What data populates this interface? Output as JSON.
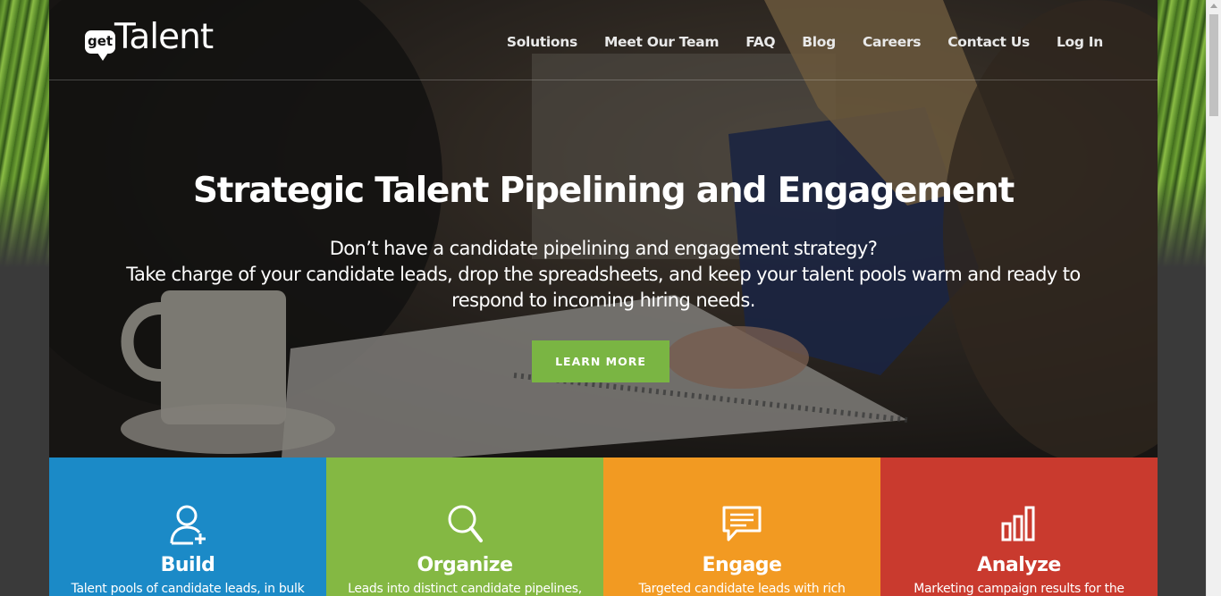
{
  "logo": {
    "badge": "get",
    "text": "Talent"
  },
  "nav": {
    "items": [
      {
        "label": "Solutions"
      },
      {
        "label": "Meet Our Team"
      },
      {
        "label": "FAQ"
      },
      {
        "label": "Blog"
      },
      {
        "label": "Careers"
      },
      {
        "label": "Contact Us"
      },
      {
        "label": "Log In"
      }
    ]
  },
  "hero": {
    "title": "Strategic Talent Pipelining and Engagement",
    "subtitle_line1": "Don’t have a candidate pipelining and engagement strategy?",
    "subtitle_line2": "Take charge of your candidate leads, drop the spreadsheets, and keep your talent pools warm and ready to respond to incoming hiring needs.",
    "cta_label": "LEARN MORE"
  },
  "tiles": [
    {
      "title": "Build",
      "desc": "Talent pools of candidate leads, in bulk",
      "color": "#1b8ac7",
      "icon": "add-user-icon"
    },
    {
      "title": "Organize",
      "desc": "Leads into distinct candidate pipelines,",
      "color": "#84b843",
      "icon": "search-icon"
    },
    {
      "title": "Engage",
      "desc": "Targeted candidate leads with rich",
      "color": "#f29a22",
      "icon": "chat-icon"
    },
    {
      "title": "Analyze",
      "desc": "Marketing campaign results for the",
      "color": "#c93a2e",
      "icon": "bar-chart-icon"
    }
  ],
  "colors": {
    "accent_green": "#7ab543",
    "nav_text": "#e9e9e9"
  }
}
